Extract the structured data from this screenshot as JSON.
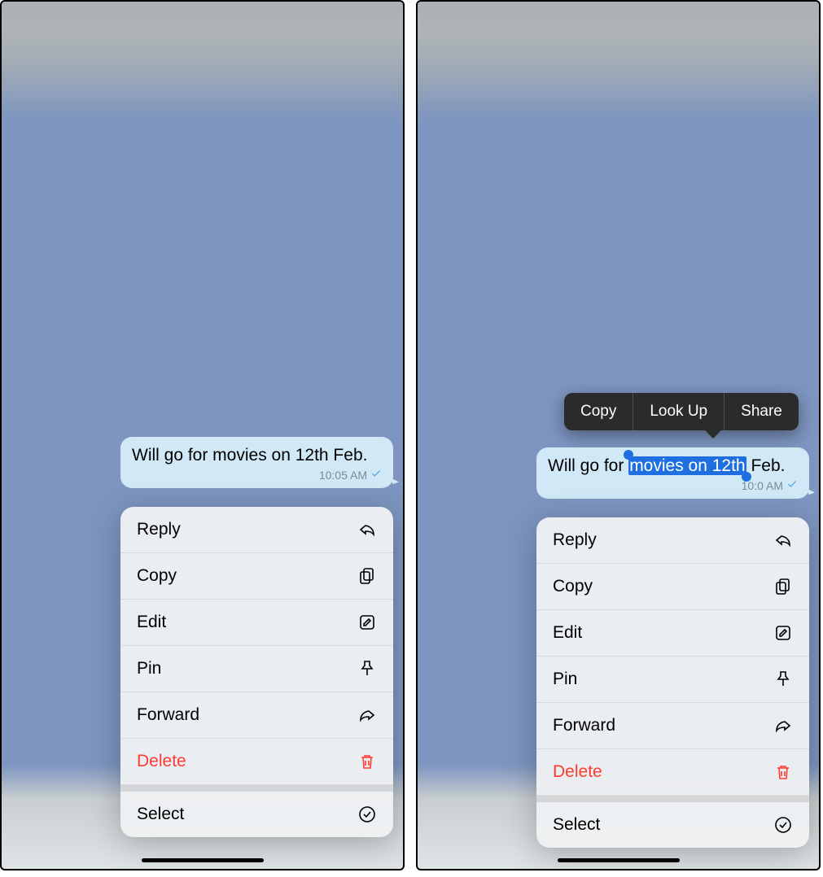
{
  "left": {
    "message": {
      "pre": "Will go for movies on 12th Feb.",
      "highlight": "",
      "post": "",
      "time": "10:05 AM"
    },
    "menu": {
      "reply": "Reply",
      "copy": "Copy",
      "edit": "Edit",
      "pin": "Pin",
      "forward": "Forward",
      "delete": "Delete",
      "select": "Select"
    }
  },
  "right": {
    "message": {
      "pre": "Will go for ",
      "highlight": "movies on 12th",
      "post": " Feb.",
      "time": "10:0   AM"
    },
    "selection_popup": {
      "copy": "Copy",
      "lookup": "Look Up",
      "share": "Share"
    },
    "menu": {
      "reply": "Reply",
      "copy": "Copy",
      "edit": "Edit",
      "pin": "Pin",
      "forward": "Forward",
      "delete": "Delete",
      "select": "Select"
    }
  }
}
